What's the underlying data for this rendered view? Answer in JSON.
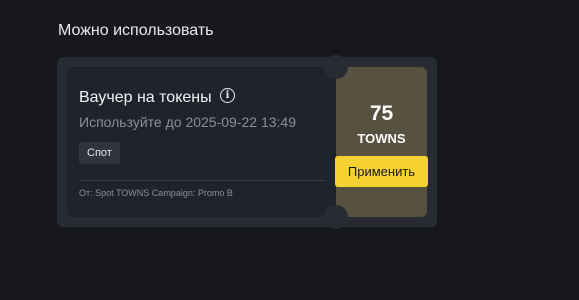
{
  "section": {
    "title": "Можно использовать"
  },
  "voucher": {
    "title": "Ваучер на токены",
    "info_icon": "info-icon",
    "expiry_text": "Используйте до 2025-09-22 13:49",
    "tag": "Спот",
    "source": "От: Spot TOWNS Campaign: Promo B",
    "amount": "75",
    "currency": "TOWNS",
    "apply_label": "Применить"
  },
  "colors": {
    "background": "#17181b",
    "panel": "#282c32",
    "card": "#1f242b",
    "reward_side": "#575140",
    "accent_button": "#f5d131"
  }
}
